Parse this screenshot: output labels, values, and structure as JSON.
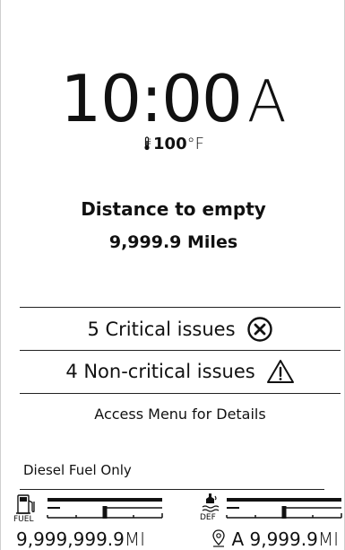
{
  "clock": {
    "time": "10:00",
    "ampm": "A"
  },
  "temperature": {
    "icon": "thermometer-icon",
    "value": "100",
    "unit": "°F"
  },
  "distance_to_empty": {
    "label": "Distance to empty",
    "value": "9,999.9 Miles"
  },
  "issues": [
    {
      "label": "5 Critical issues",
      "icon": "critical-x-circle-icon"
    },
    {
      "label": "4 Non-critical issues",
      "icon": "warning-triangle-icon"
    }
  ],
  "access_menu_text": "Access Menu for Details",
  "fuel_note": "Diesel Fuel Only",
  "gauges": {
    "fuel": {
      "icon": "fuel-pump-icon",
      "label": "FUEL",
      "level": 0.5,
      "range_value": "9,999,999.9",
      "range_unit": "MI"
    },
    "def": {
      "icon": "def-fluid-icon",
      "label": "DEF",
      "level": 0.5,
      "range_icon": "location-pin-icon",
      "range_prefix": "A",
      "range_value": "9,999.9",
      "range_unit": "MI"
    }
  },
  "colors": {
    "background": "#ffffff",
    "foreground": "#111111",
    "divider": "#222222"
  }
}
